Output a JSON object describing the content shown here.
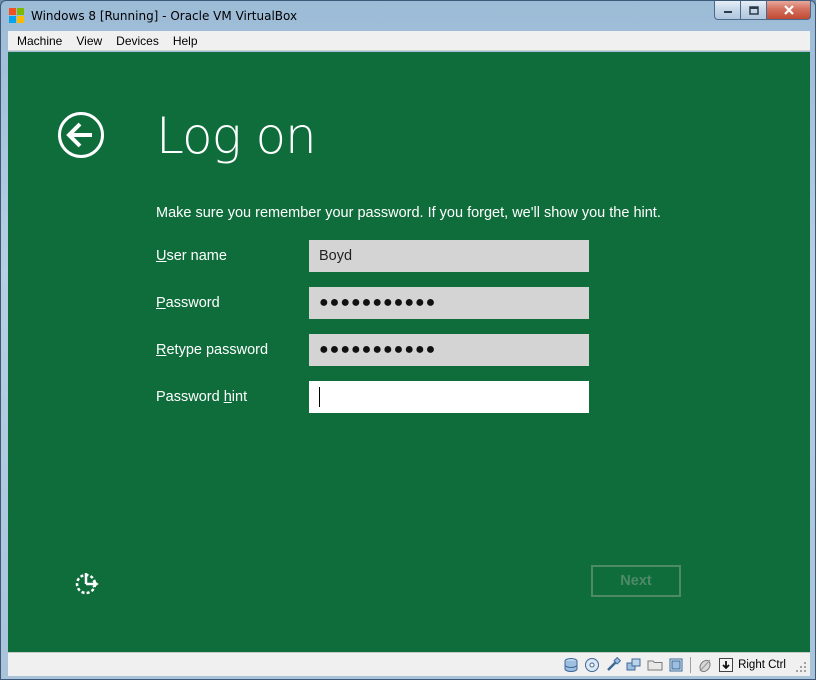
{
  "window": {
    "title": "Windows 8 [Running] - Oracle VM VirtualBox"
  },
  "menubar": {
    "items": [
      "Machine",
      "View",
      "Devices",
      "Help"
    ]
  },
  "setup": {
    "title": "Log on",
    "instructions": "Make sure you remember your password. If you forget, we'll show you the hint.",
    "fields": [
      {
        "label_accel": "U",
        "label_rest": "ser name",
        "value": "Boyd",
        "type": "text"
      },
      {
        "label_accel": "P",
        "label_rest": "assword",
        "value": "●●●●●●●●●●●",
        "type": "password"
      },
      {
        "label_accel": "R",
        "label_rest": "etype password",
        "value": "●●●●●●●●●●●",
        "type": "password"
      },
      {
        "label_pre": "Password ",
        "label_accel": "h",
        "label_rest": "int",
        "value": "",
        "type": "text"
      }
    ],
    "next_label": "Next"
  },
  "statusbar": {
    "host_key": "Right Ctrl",
    "icons": [
      "hard-disk-icon",
      "optical-disk-icon",
      "usb-icon",
      "network-icon",
      "shared-folder-icon",
      "video-capture-icon",
      "mouse-integration-icon",
      "host-key-icon"
    ]
  },
  "colors": {
    "vm_background": "#0f6d3c",
    "field_disabled": "#d4d4d4",
    "field_active": "#ffffff",
    "next_disabled": "#4f8a67"
  }
}
